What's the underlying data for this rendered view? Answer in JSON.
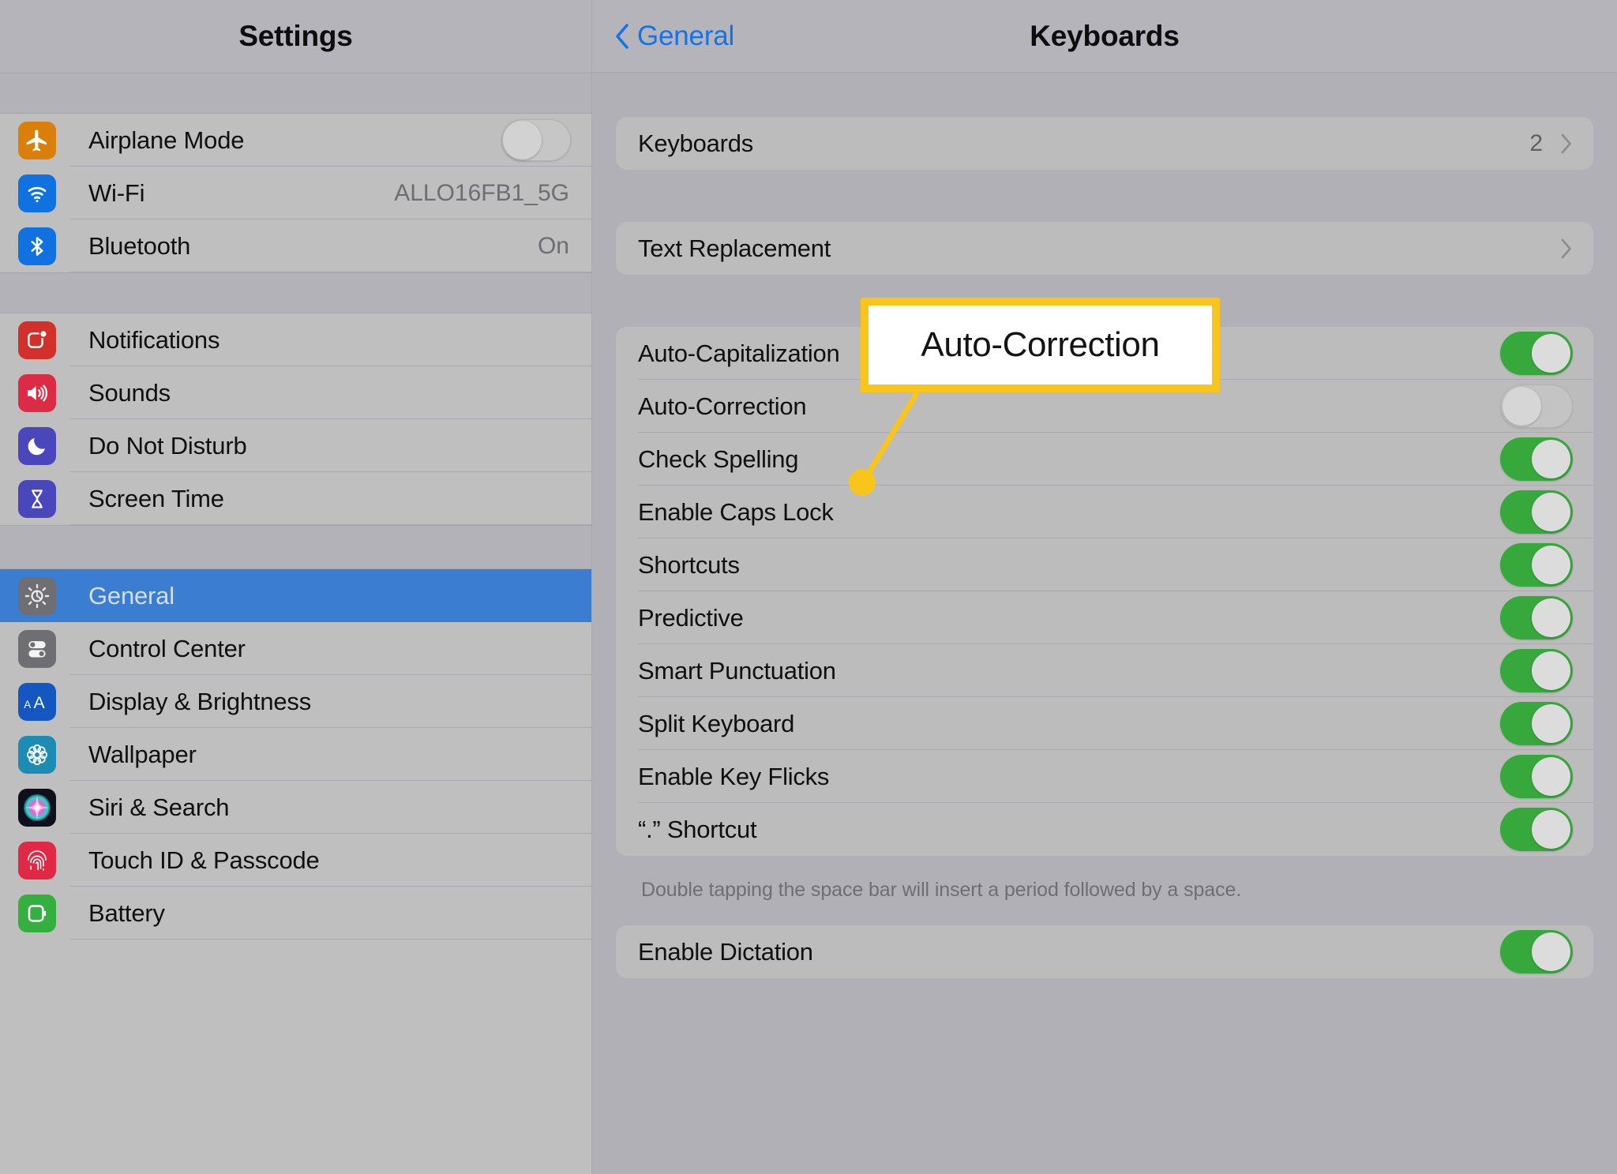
{
  "sidebar": {
    "title": "Settings",
    "groups": [
      {
        "items": [
          {
            "label": "Airplane Mode",
            "icon": "airplane-icon",
            "control": "toggle-off"
          },
          {
            "label": "Wi-Fi",
            "icon": "wifi-icon",
            "value": "ALLO16FB1_5G"
          },
          {
            "label": "Bluetooth",
            "icon": "bluetooth-icon",
            "value": "On"
          }
        ]
      },
      {
        "items": [
          {
            "label": "Notifications",
            "icon": "notifications-icon"
          },
          {
            "label": "Sounds",
            "icon": "speaker-icon"
          },
          {
            "label": "Do Not Disturb",
            "icon": "moon-icon"
          },
          {
            "label": "Screen Time",
            "icon": "hourglass-icon"
          }
        ]
      },
      {
        "items": [
          {
            "label": "General",
            "icon": "gear-icon",
            "selected": true
          },
          {
            "label": "Control Center",
            "icon": "switches-icon"
          },
          {
            "label": "Display & Brightness",
            "icon": "text-size-icon"
          },
          {
            "label": "Wallpaper",
            "icon": "flower-icon"
          },
          {
            "label": "Siri & Search",
            "icon": "siri-icon"
          },
          {
            "label": "Touch ID & Passcode",
            "icon": "fingerprint-icon"
          },
          {
            "label": "Battery",
            "icon": "battery-icon"
          }
        ]
      }
    ]
  },
  "main": {
    "back_label": "General",
    "title": "Keyboards",
    "groups": [
      {
        "id": "keyboards-group",
        "rows": [
          {
            "label": "Keyboards",
            "count": "2",
            "control": "chevron"
          }
        ]
      },
      {
        "id": "text-replacement-group",
        "rows": [
          {
            "label": "Text Replacement",
            "control": "chevron"
          }
        ]
      },
      {
        "id": "keyboard-options-group",
        "rows": [
          {
            "label": "Auto-Capitalization",
            "control": "toggle",
            "state": "on"
          },
          {
            "label": "Auto-Correction",
            "control": "toggle",
            "state": "off"
          },
          {
            "label": "Check Spelling",
            "control": "toggle",
            "state": "on"
          },
          {
            "label": "Enable Caps Lock",
            "control": "toggle",
            "state": "on"
          },
          {
            "label": "Shortcuts",
            "control": "toggle",
            "state": "on"
          },
          {
            "label": "Predictive",
            "control": "toggle",
            "state": "on"
          },
          {
            "label": "Smart Punctuation",
            "control": "toggle",
            "state": "on"
          },
          {
            "label": "Split Keyboard",
            "control": "toggle",
            "state": "on"
          },
          {
            "label": "Enable Key Flicks",
            "control": "toggle",
            "state": "on"
          },
          {
            "label": "“.” Shortcut",
            "control": "toggle",
            "state": "on"
          }
        ],
        "footnote": "Double tapping the space bar will insert a period followed by a space."
      },
      {
        "id": "dictation-group",
        "rows": [
          {
            "label": "Enable Dictation",
            "control": "toggle",
            "state": "on"
          }
        ]
      }
    ]
  },
  "callout": {
    "text": "Auto-Correction"
  },
  "colors": {
    "accent_blue": "#1573e6",
    "selected_row": "#3b7dd0",
    "toggle_on_green": "#37a93c",
    "callout_yellow": "#f9c51c",
    "panel_bg": "#b0b0b6",
    "sidebar_bg": "#bfbfbf"
  }
}
